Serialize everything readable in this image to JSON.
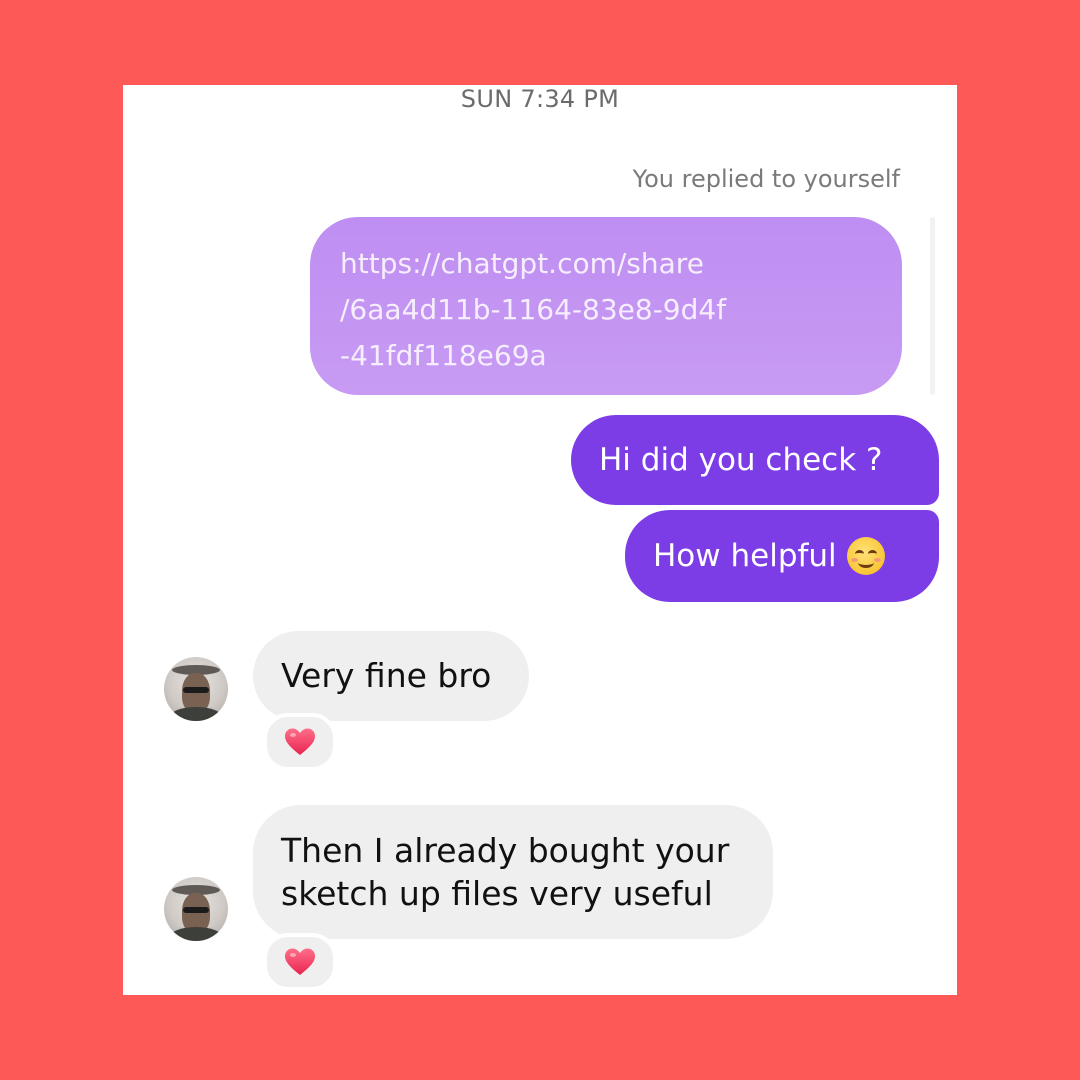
{
  "conversation": {
    "timestamp": "SUN 7:34 PM",
    "reply_note": "You replied to yourself",
    "link_message": {
      "lines": [
        "https://chatgpt.com/share",
        "/6aa4d11b-1164-83e8-9d4f",
        "-41fdf118e69a"
      ]
    },
    "outgoing": [
      {
        "text": "Hi did you check ?"
      },
      {
        "text": "How helpful",
        "emoji": "smiling-face-icon"
      }
    ],
    "incoming": [
      {
        "lines": [
          "Very fine bro"
        ],
        "reaction": "heart-icon"
      },
      {
        "lines": [
          "Then I already bought your",
          "sketch up files very useful"
        ],
        "reaction": "heart-icon"
      }
    ]
  },
  "colors": {
    "frame": "#fd5a57",
    "outgoing_bubble": "#7c3de6",
    "link_bubble": "#c494f3",
    "incoming_bubble": "#efefef",
    "reaction_heart": "#f23a63"
  }
}
